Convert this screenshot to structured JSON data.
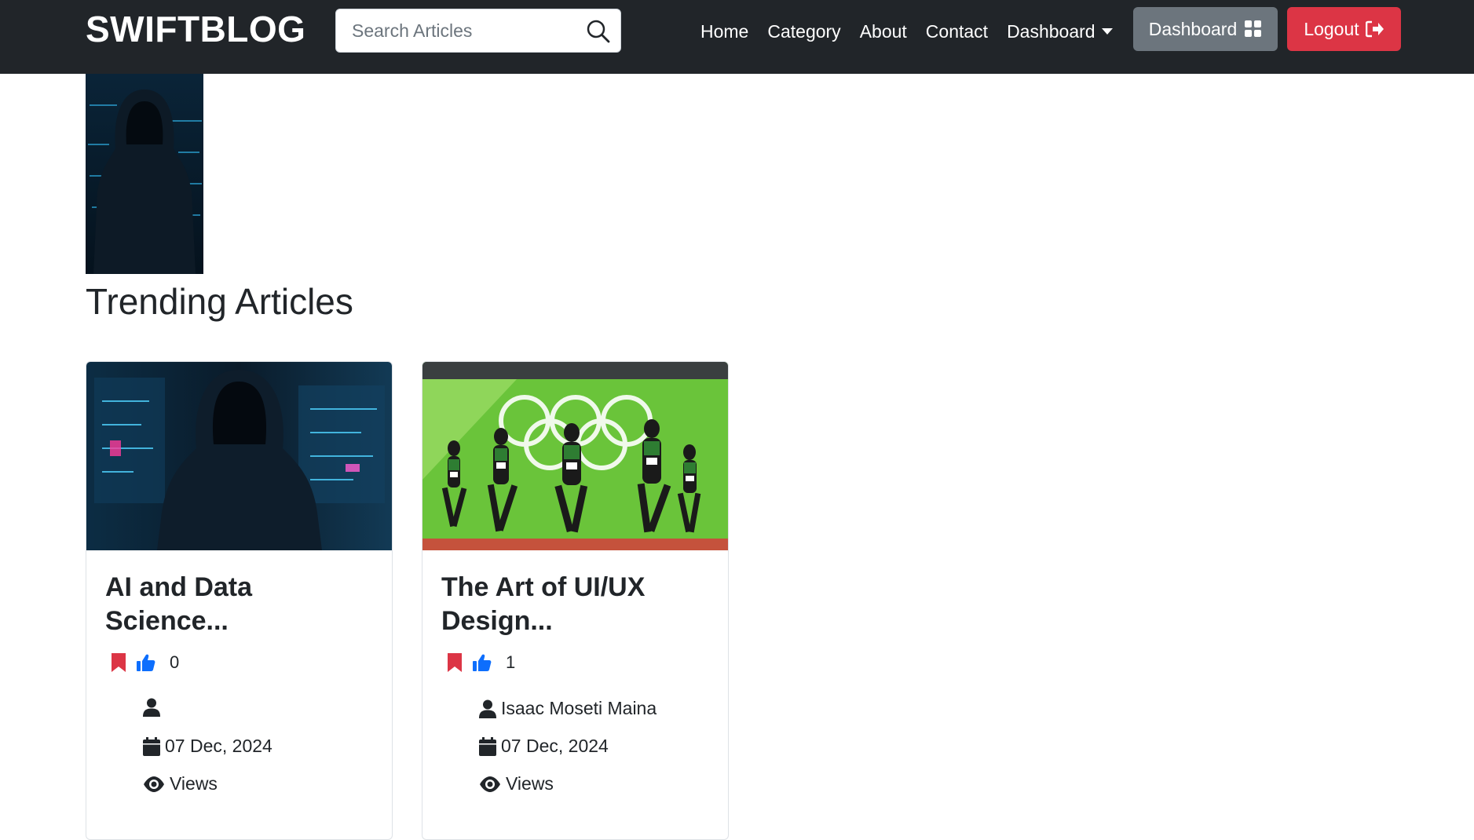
{
  "navbar": {
    "brand": "SWIFTBLOG",
    "search": {
      "placeholder": "Search Articles",
      "value": ""
    },
    "links": [
      "Home",
      "Category",
      "About",
      "Contact"
    ],
    "dropdown_label": "Dashboard",
    "dashboard_button": "Dashboard",
    "logout_button": "Logout",
    "colors": {
      "bar": "#212529",
      "dashboard": "#6c757d",
      "logout": "#dc3545"
    }
  },
  "hero": {
    "image": "hooded-hacker-image"
  },
  "main": {
    "section_title": "Trending Articles",
    "articles": [
      {
        "title": "AI and Data Science...",
        "image": "hooded-hacker-image",
        "likes": "0",
        "author": "",
        "date": "07 Dec, 2024",
        "views_label": "Views"
      },
      {
        "title": "The Art of UI/UX Design...",
        "image": "runners-race-image",
        "likes": "1",
        "author": "Isaac Moseti Maina",
        "date": "07 Dec, 2024",
        "views_label": "Views"
      }
    ]
  },
  "colors": {
    "bookmark": "#dc3545",
    "like": "#0d6efd"
  }
}
